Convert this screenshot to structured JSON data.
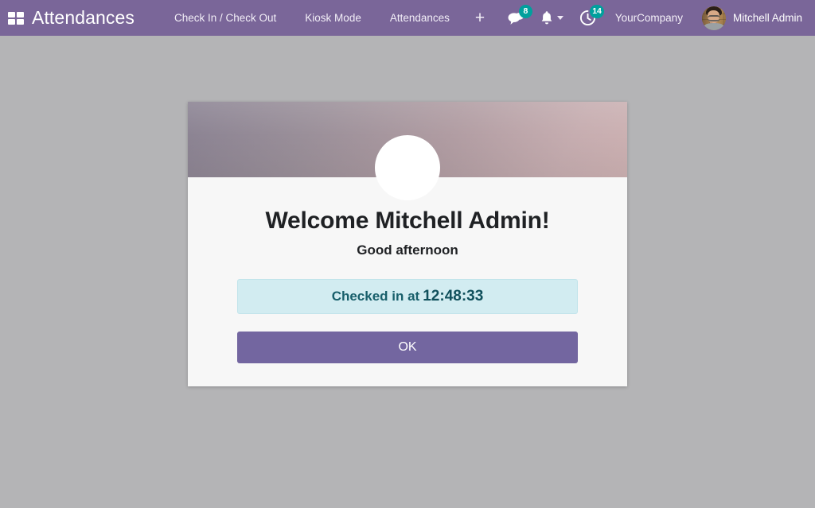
{
  "navbar": {
    "apps_icon": "grid-apps-icon",
    "brand": "Attendances",
    "menu_items": [
      {
        "label": "Check In / Check Out"
      },
      {
        "label": "Kiosk Mode"
      },
      {
        "label": "Attendances"
      }
    ],
    "add_label": "+",
    "systray": {
      "messages": {
        "icon": "chat-bubble-icon",
        "count": "8"
      },
      "activities": {
        "icon": "bell-icon",
        "has_caret": true
      },
      "clock": {
        "icon": "clock-icon",
        "count": "14"
      }
    },
    "company": "YourCompany",
    "user": {
      "name": "Mitchell Admin",
      "avatar": "user-avatar"
    },
    "accent_color": "#7a6699",
    "badge_color": "#00a09d"
  },
  "modal": {
    "avatar": "employee-avatar",
    "title": "Welcome Mitchell Admin!",
    "greeting": "Good afternoon",
    "status_prefix": "Checked in at",
    "status_time": "12:48:33",
    "ok_label": "OK",
    "status_bg": "#d2ecf1",
    "status_text_color": "#185f6b",
    "ok_bg": "#7366a0"
  },
  "page": {
    "background_color": "#b4b4b6"
  }
}
